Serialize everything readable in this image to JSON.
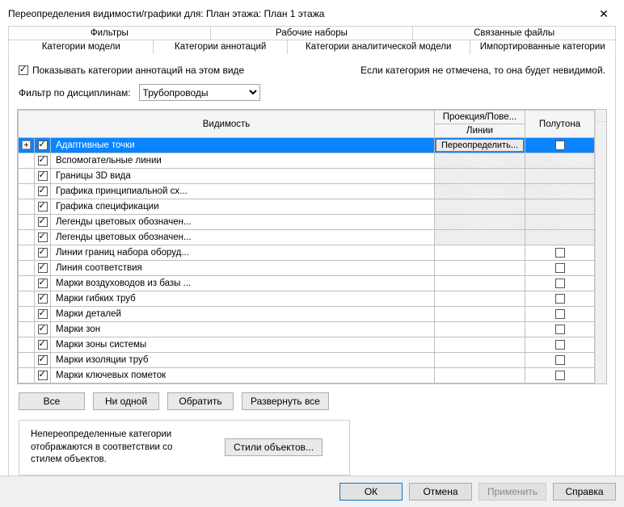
{
  "window": {
    "title": "Переопределения видимости/графики для: План этажа: План 1 этажа"
  },
  "tabs_top": [
    "Фильтры",
    "Рабочие наборы",
    "Связанные файлы"
  ],
  "tabs_second": [
    "Категории модели",
    "Категории аннотаций",
    "Категории аналитической модели",
    "Импортированные категории"
  ],
  "active_tab_second": 1,
  "show_categories_label": "Показывать категории аннотаций на этом виде",
  "show_categories_checked": true,
  "hint_right": "Если категория не отмечена, то она будет невидимой.",
  "filter_label": "Фильтр по дисциплинам:",
  "filter_value": "Трубопроводы",
  "columns": {
    "visibility": "Видимость",
    "projection": "Проекция/Пове...",
    "lines": "Линии",
    "halftone": "Полутона"
  },
  "override_button": "Переопределить...",
  "rows": [
    {
      "name": "Адаптивные точки",
      "checked": true,
      "selected": true,
      "expandable": true,
      "halftone": false,
      "proj_grey": false,
      "half_show": true
    },
    {
      "name": "Вспомогательные линии",
      "checked": true,
      "proj_grey": true,
      "half_show": false
    },
    {
      "name": "Границы 3D вида",
      "checked": true,
      "proj_grey": true,
      "half_show": false
    },
    {
      "name": "Графика принципиальной сх...",
      "checked": true,
      "proj_grey": true,
      "half_show": false
    },
    {
      "name": "Графика спецификации",
      "checked": true,
      "proj_grey": true,
      "half_show": false
    },
    {
      "name": "Легенды цветовых обозначен...",
      "checked": true,
      "proj_grey": true,
      "half_show": false
    },
    {
      "name": "Легенды цветовых обозначен...",
      "checked": true,
      "proj_grey": true,
      "half_show": false
    },
    {
      "name": "Линии границ набора оборуд...",
      "checked": true,
      "proj_grey": false,
      "half_show": true,
      "halftone": false
    },
    {
      "name": "Линия соответствия",
      "checked": true,
      "proj_grey": false,
      "half_show": true,
      "halftone": false
    },
    {
      "name": "Марки воздуховодов из базы ...",
      "checked": true,
      "proj_grey": false,
      "half_show": true,
      "halftone": false
    },
    {
      "name": "Марки гибких труб",
      "checked": true,
      "proj_grey": false,
      "half_show": true,
      "halftone": false
    },
    {
      "name": "Марки деталей",
      "checked": true,
      "proj_grey": false,
      "half_show": true,
      "halftone": false
    },
    {
      "name": "Марки зон",
      "checked": true,
      "proj_grey": false,
      "half_show": true,
      "halftone": false
    },
    {
      "name": "Марки зоны системы",
      "checked": true,
      "proj_grey": false,
      "half_show": true,
      "halftone": false
    },
    {
      "name": "Марки изоляции труб",
      "checked": true,
      "proj_grey": false,
      "half_show": true,
      "halftone": false
    },
    {
      "name": "Марки ключевых пометок",
      "checked": true,
      "proj_grey": false,
      "half_show": true,
      "halftone": false
    }
  ],
  "buttons": {
    "all": "Все",
    "none": "Ни одной",
    "invert": "Обратить",
    "expand_all": "Развернуть все"
  },
  "info_text": "Непереопределенные категории отображаются в соответствии со стилем объектов.",
  "styles_button": "Стили объектов...",
  "footer": {
    "ok": "ОК",
    "cancel": "Отмена",
    "apply": "Применить",
    "help": "Справка"
  }
}
